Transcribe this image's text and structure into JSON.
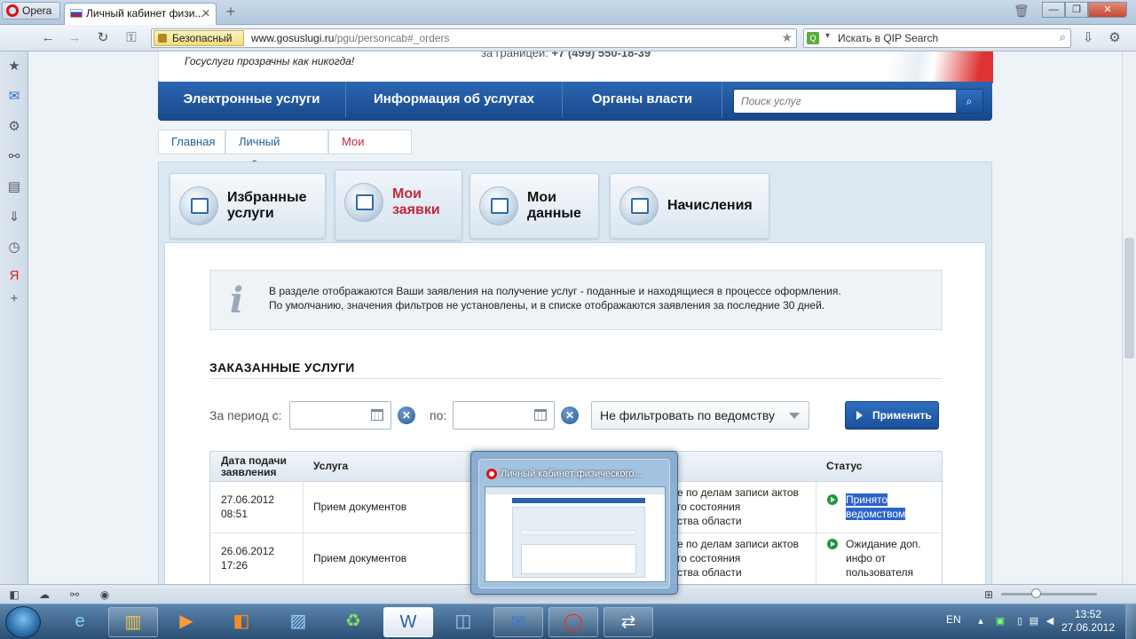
{
  "browser": {
    "menu_label": "Opera",
    "tab_title": "Личный кабинет физи...",
    "security_label": "Безопасный",
    "url_domain": "www.gosuslugi.ru",
    "url_path": "/pgu/personcab#_orders",
    "search_engine_placeholder": "Искать в QIP Search"
  },
  "site": {
    "slogan": "Госуслуги прозрачны как никогда!",
    "phone_label": "за границей:",
    "phone": "+7 (499) 550-18-39",
    "nav": [
      "Электронные услуги",
      "Информация об услугах",
      "Органы власти"
    ],
    "search_placeholder": "Поиск услуг",
    "breadcrumb": [
      "Главная",
      "Личный кабинет",
      "Мои заявки"
    ]
  },
  "tabs": {
    "favorites": "Избранные услуги",
    "orders": "Мои заявки",
    "mydata": "Мои данные",
    "charges": "Начисления"
  },
  "info": {
    "line1": "В разделе отображаются Ваши заявления на получение услуг - поданные и находящиеся в процессе оформления.",
    "line2": "По умолчанию, значения фильтров не установлены, и в списке отображаются заявления за последние 30 дней."
  },
  "orders": {
    "section_title": "ЗАКАЗАННЫЕ УСЛУГИ",
    "period_from_label": "За период с:",
    "period_to_label": "по:",
    "from_value": "",
    "to_value": "",
    "department_filter": "Не фильтровать по ведомству",
    "apply_label": "Применить",
    "columns": {
      "date": "Дата подачи заявления",
      "service": "Услуга",
      "status": "Статус"
    },
    "rows": [
      {
        "date": "27.06.2012",
        "time": "08:51",
        "service": "Прием документов",
        "dept_line1": "е по делам записи актов",
        "dept_line2": "го состояния",
        "dept_line3": "ства области",
        "status_line1": "Принято",
        "status_line2": "ведомством"
      },
      {
        "date": "26.06.2012",
        "time": "17:26",
        "service": "Прием документов",
        "dept_line1": "е по делам записи актов",
        "dept_line2": "го состояния",
        "dept_line3": "ства области",
        "status_line1": "Ожидание доп.",
        "status_line2": "инфо от",
        "status_line3": "пользователя"
      }
    ]
  },
  "preview": {
    "title": "Личный кабинет физического..."
  },
  "taskbar": {
    "lang": "EN",
    "time": "13:52",
    "date": "27.06.2012"
  },
  "colors": {
    "nav_blue": "#19478a",
    "active_red": "#c2283c",
    "status_green": "#1a9a3a",
    "selection_blue": "#2b64c9"
  }
}
